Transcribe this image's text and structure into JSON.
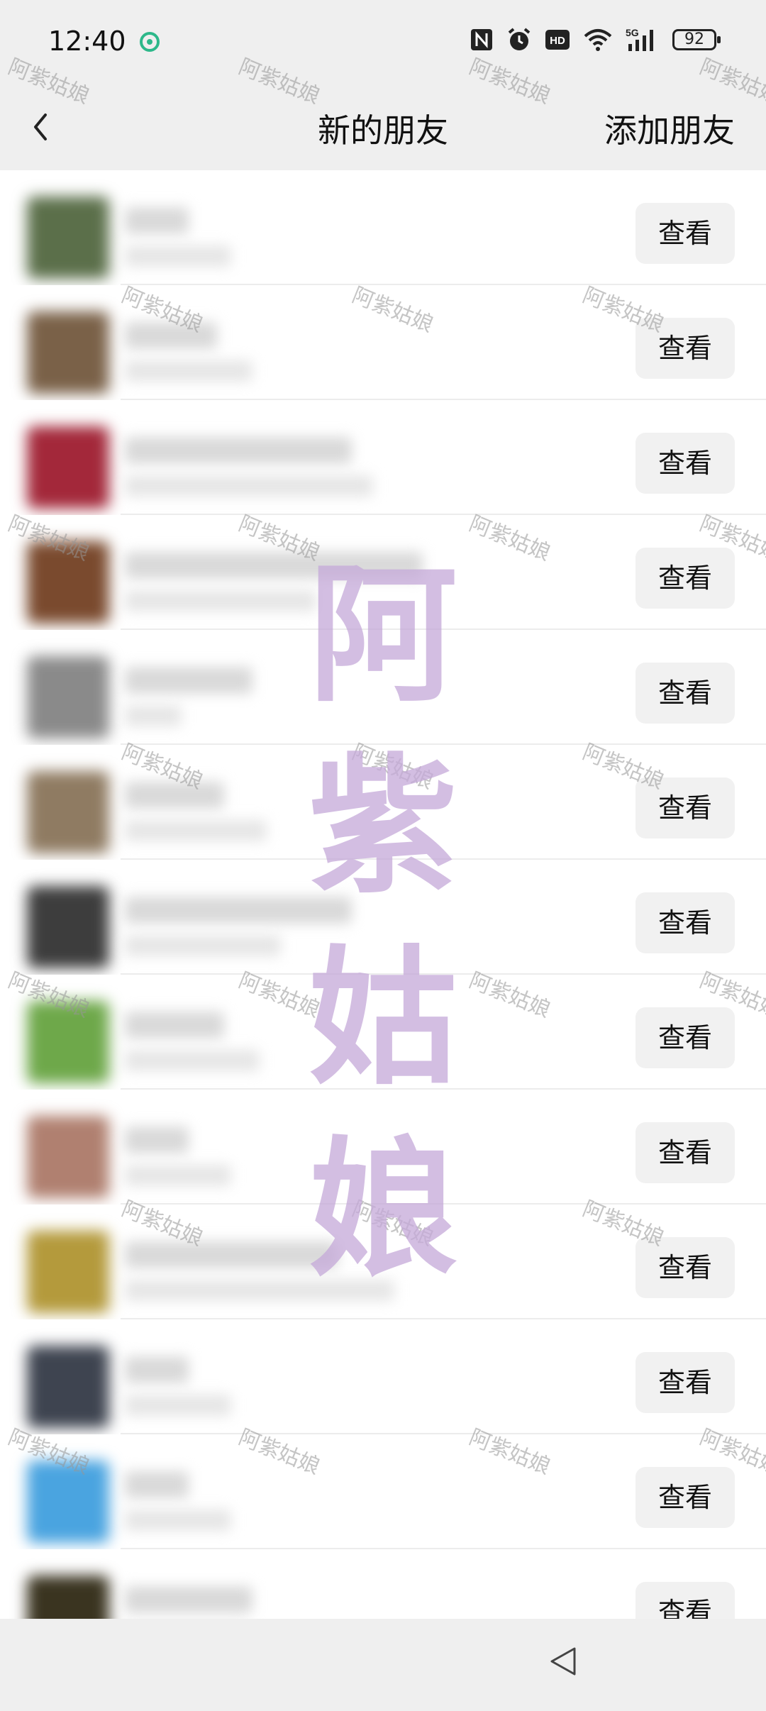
{
  "status_bar": {
    "time": "12:40",
    "battery": "92",
    "network": "5G",
    "icons": [
      "app-badge-icon",
      "nfc-icon",
      "alarm-icon",
      "hd-icon",
      "wifi-icon",
      "signal-icon",
      "battery-icon"
    ]
  },
  "header": {
    "title": "新的朋友",
    "action": "添加朋友"
  },
  "rows": [
    {
      "button": "查看"
    },
    {
      "button": "查看"
    },
    {
      "button": "查看"
    },
    {
      "button": "查看"
    },
    {
      "button": "查看"
    },
    {
      "button": "查看"
    },
    {
      "button": "查看"
    },
    {
      "button": "查看"
    },
    {
      "button": "查看"
    },
    {
      "button": "查看"
    },
    {
      "button": "查看"
    },
    {
      "button": "查看"
    },
    {
      "button": "查看"
    }
  ],
  "watermark": {
    "small": "阿紫姑娘",
    "large": [
      "阿",
      "紫",
      "姑",
      "娘"
    ],
    "color": "#c4a8d8"
  },
  "avatar_colors": [
    "#5b6f4a",
    "#7a6148",
    "#a3283a",
    "#7a4a2e",
    "#8a8a8a",
    "#8f7b62",
    "#3d3d3d",
    "#6ea84a",
    "#b08070",
    "#b49a3c",
    "#3e4450",
    "#4aa4e0",
    "#3a3420"
  ]
}
